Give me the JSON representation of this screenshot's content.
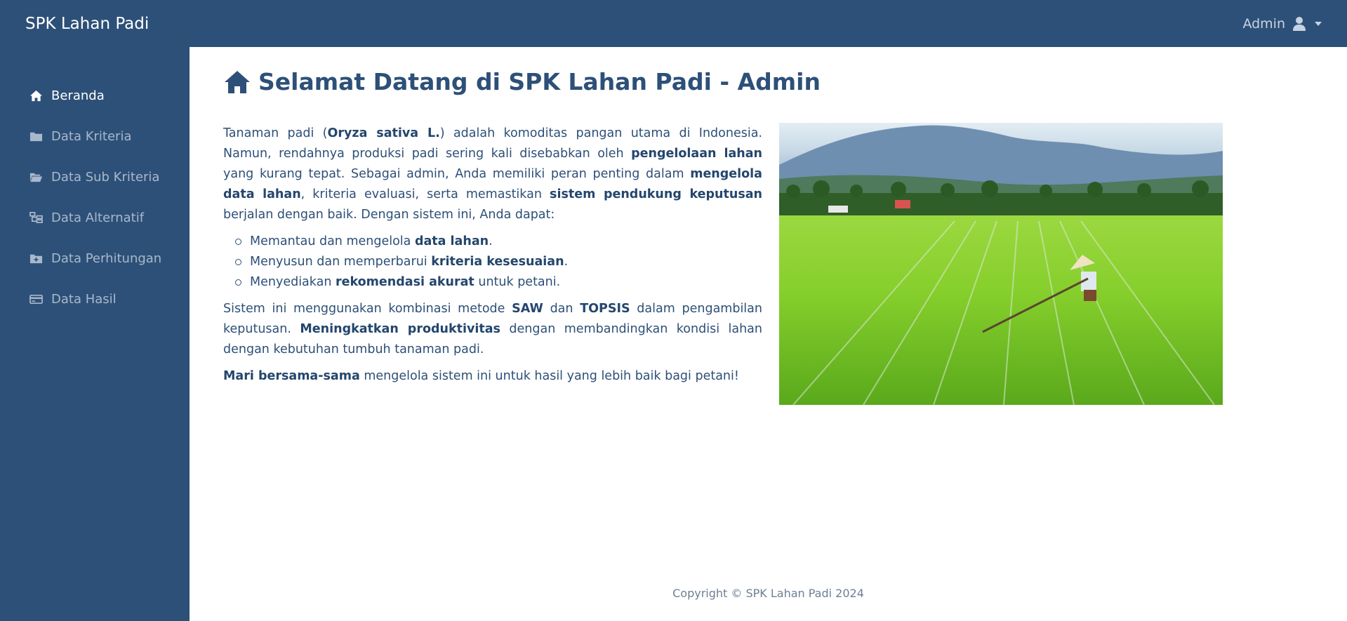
{
  "header": {
    "brand": "SPK Lahan Padi",
    "user_label": "Admin"
  },
  "sidebar": {
    "items": [
      {
        "label": "Beranda",
        "icon": "home-icon",
        "active": true
      },
      {
        "label": "Data Kriteria",
        "icon": "folder-icon",
        "active": false
      },
      {
        "label": "Data Sub Kriteria",
        "icon": "folder-open-icon",
        "active": false
      },
      {
        "label": "Data Alternatif",
        "icon": "sitemap-icon",
        "active": false
      },
      {
        "label": "Data Perhitungan",
        "icon": "folder-plus-icon",
        "active": false
      },
      {
        "label": "Data Hasil",
        "icon": "credit-card-icon",
        "active": false
      }
    ]
  },
  "main": {
    "title": "Selamat Datang di SPK Lahan Padi - Admin",
    "intro": {
      "t1": "Tanaman padi (",
      "b1": "Oryza sativa L.",
      "t2": ") adalah komoditas pangan utama di Indonesia. Namun, rendahnya produksi padi sering kali disebabkan oleh ",
      "b2": "pengelolaan lahan",
      "t3": " yang kurang tepat. Sebagai admin, Anda memiliki peran penting dalam ",
      "b3": "mengelola data lahan",
      "t4": ", kriteria evaluasi, serta memastikan ",
      "b4": "sistem pendukung keputusan",
      "t5": " berjalan dengan baik. Dengan sistem ini, Anda dapat:"
    },
    "list": [
      {
        "pre": "Memantau dan mengelola ",
        "bold": "data lahan",
        "post": "."
      },
      {
        "pre": "Menyusun dan memperbarui ",
        "bold": "kriteria kesesuaian",
        "post": "."
      },
      {
        "pre": "Menyediakan ",
        "bold": "rekomendasi akurat",
        "post": " untuk petani."
      }
    ],
    "method": {
      "t1": "Sistem ini menggunakan kombinasi metode ",
      "b1": "SAW",
      "t2": " dan ",
      "b2": "TOPSIS",
      "t3": " dalam pengambilan keputusan. ",
      "b3": "Meningkatkan produktivitas",
      "t4": " dengan membandingkan kondisi lahan dengan kebutuhan tumbuh tanaman padi."
    },
    "closing": {
      "b1": "Mari bersama-sama",
      "t1": " mengelola sistem ini untuk hasil yang lebih baik bagi petani!"
    }
  },
  "footer": {
    "copyright": "Copyright © SPK Lahan Padi 2024"
  },
  "colors": {
    "primary": "#2d5078",
    "text": "#2d4f77",
    "sidebar_inactive": "#a9b8cb"
  }
}
